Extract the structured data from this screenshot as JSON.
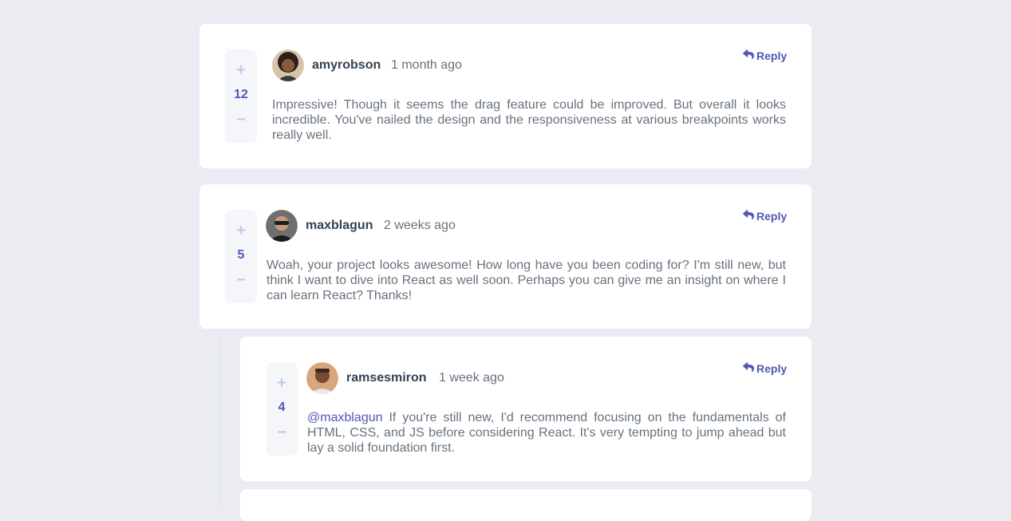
{
  "colors": {
    "background": "#eaecf1",
    "card": "#ffffff",
    "accent": "#5357b6",
    "vote_light": "#c5c6ef",
    "text_dark": "#334253",
    "text_muted": "#67727e"
  },
  "comments": [
    {
      "score": "12",
      "plus": "+",
      "minus": "−",
      "username": "amyrobson",
      "time": "1 month ago",
      "reply_label": "Reply",
      "text": "Impressive! Though it seems the drag feature could be improved. But overall it looks incredible. You've nailed the design and the responsiveness at various breakpoints works really well."
    },
    {
      "score": "5",
      "plus": "+",
      "minus": "−",
      "username": "maxblagun",
      "time": "2 weeks ago",
      "reply_label": "Reply",
      "text": "Woah, your project looks awesome! How long have you been coding for? I'm still new, but think I want to dive into React as well soon. Perhaps you can give me an insight on where I can learn React? Thanks!"
    },
    {
      "score": "4",
      "plus": "+",
      "minus": "−",
      "username": "ramsesmiron",
      "time": "1 week ago",
      "reply_label": "Reply",
      "mention": "@maxblagun",
      "text": " If you're still new, I'd recommend focusing on the fundamentals of HTML, CSS, and JS before considering React. It's very tempting to jump ahead but lay a solid foundation first."
    }
  ]
}
